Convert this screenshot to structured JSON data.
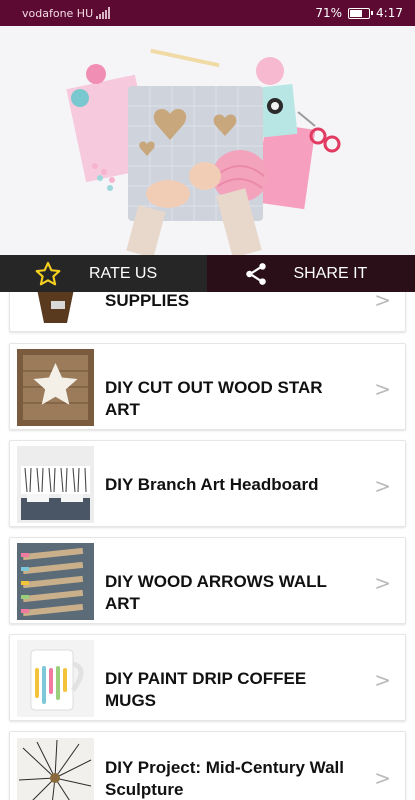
{
  "status_bar": {
    "carrier": "vodafone HU",
    "battery": "71%",
    "time": "4:17",
    "battery_level": 0.71
  },
  "actions": {
    "rate_label": "RATE US",
    "share_label": "SHARE IT"
  },
  "items": [
    {
      "title": "SUPPLIES",
      "thumb": "wood-frame"
    },
    {
      "title": "DIY CUT OUT WOOD STAR ART",
      "thumb": "wood-star"
    },
    {
      "title": "DIY Branch Art Headboard",
      "thumb": "branch-headboard"
    },
    {
      "title": "DIY WOOD ARROWS WALL ART",
      "thumb": "wood-arrows"
    },
    {
      "title": "DIY PAINT DRIP COFFEE MUGS",
      "thumb": "drip-mug"
    },
    {
      "title": "DIY Project: Mid-Century Wall Sculpture",
      "thumb": "wall-sculpture"
    }
  ],
  "chevron": ">",
  "colors": {
    "status_bar": "#5d0a33",
    "accent_star": "#f5d020"
  }
}
